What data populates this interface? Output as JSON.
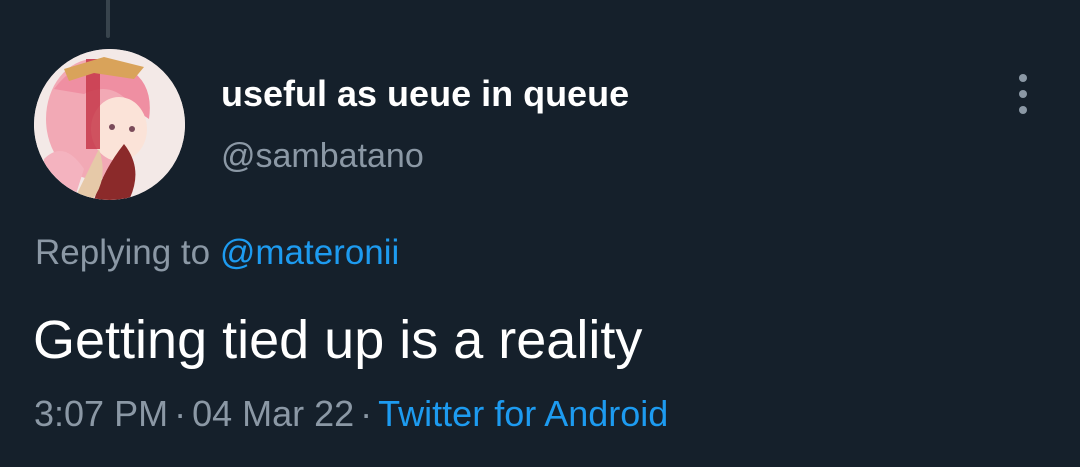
{
  "tweet": {
    "author": {
      "display_name": "useful as ueue in queue",
      "handle": "@sambatano",
      "avatar": "anime-character-avatar"
    },
    "replying_to_prefix": "Replying to",
    "replying_to_handle": "@materonii",
    "text": "Getting tied up is a reality",
    "time": "3:07 PM",
    "separator": "·",
    "date": "04 Mar 22",
    "source": "Twitter for Android"
  },
  "icons": {
    "more": "more-vertical-icon"
  },
  "colors": {
    "background": "#15202b",
    "primary_text": "#ffffff",
    "secondary_text": "#8b98a5",
    "link": "#1d9bf0"
  }
}
